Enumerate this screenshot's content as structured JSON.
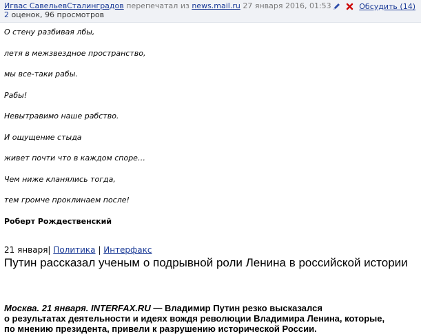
{
  "header": {
    "author": "Игвас СавельевСталинградов",
    "reposted_text": "перепечатал из",
    "source": "news.mail.ru",
    "date": "27 января 2016, 01:53",
    "ratings": "2",
    "ratings_label": "оценок,",
    "views": "96 просмотров",
    "discuss": "Обсудить (14)"
  },
  "poem": {
    "lines": [
      "О стену разбивая лбы,",
      "летя в межзвездное пространство,",
      "мы все-таки рабы.",
      "Рабы!",
      "Невытравимо наше рабство.",
      "И ощущение стыда",
      "живет почти что в каждом споре…",
      "Чем ниже кланялись тогда,",
      "тем громче проклинаем после!"
    ],
    "author": "Роберт Рождественский"
  },
  "news": {
    "date": "21 января",
    "sep1": "|",
    "category": "Политика",
    "sep2": "|",
    "agency": "Интерфакс",
    "headline": "Путин рассказал ученым о подрывной роли Ленина в российской истории",
    "lead_prefix": "Москва. 21 января. INTERFAX.RU",
    "lead_line1": " — Владимир Путин резко высказался",
    "lead_line2": "о результатах деятельности и идеях вождя революции Владимира Ленина, которые,",
    "lead_line3": "по мнению президента, привели к разрушению исторической России."
  },
  "colors": {
    "link": "#1a3a96",
    "header_bg": "#f0f2f6",
    "edit_icon": "#2a4aa8",
    "delete_icon": "#cc0000"
  },
  "icons": {
    "edit": "pencil-icon",
    "delete": "delete-x-icon"
  }
}
